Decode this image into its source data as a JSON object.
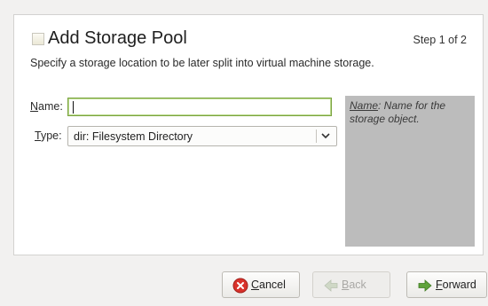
{
  "header": {
    "title": "Add Storage Pool",
    "step": "Step 1 of 2",
    "subtitle": "Specify a storage location to be later split into virtual machine storage.",
    "icon": "document-icon"
  },
  "form": {
    "name_label_mn": "N",
    "name_label_rest": "ame:",
    "name_value": "",
    "type_label_mn": "T",
    "type_label_rest": "ype:",
    "type_value": "dir: Filesystem Directory"
  },
  "help": {
    "term": "Name",
    "text": ": Name for the storage object."
  },
  "buttons": {
    "cancel_mn": "C",
    "cancel_rest": "ancel",
    "back_mn": "B",
    "back_rest": "ack",
    "forward_mn": "F",
    "forward_rest": "orward"
  },
  "colors": {
    "accent_focus": "#7ba33f",
    "help_bg": "#bcbcbc",
    "cancel_icon": "#d9322b",
    "forward_icon": "#5fa33a"
  }
}
